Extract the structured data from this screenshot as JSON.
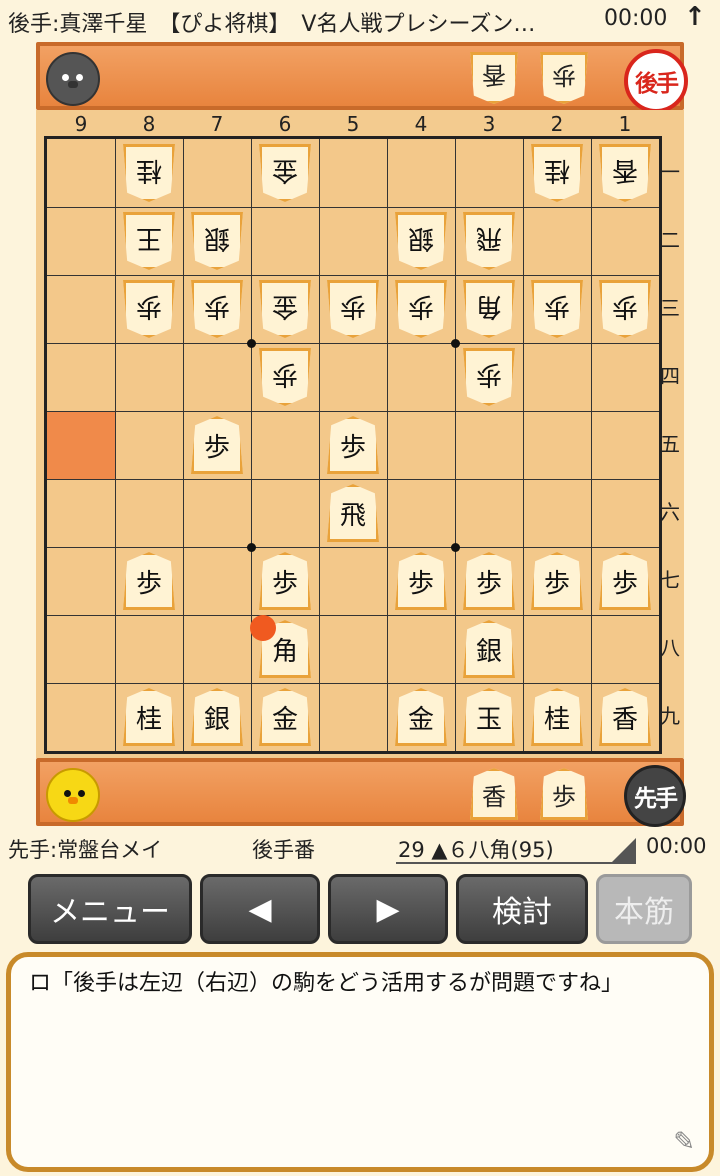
{
  "header": {
    "title": "後手:真澤千星　【ぴよ将棋】　V名人戦プレシーズン…",
    "clock": "00:00",
    "arrow_icon": "up-arrow-icon"
  },
  "gote": {
    "badge": "後手",
    "hand": [
      "香",
      "歩"
    ]
  },
  "sente": {
    "badge": "先手",
    "hand": [
      "香",
      "歩"
    ]
  },
  "files": [
    "9",
    "8",
    "7",
    "6",
    "5",
    "4",
    "3",
    "2",
    "1"
  ],
  "ranks": [
    "一",
    "二",
    "三",
    "四",
    "五",
    "六",
    "七",
    "八",
    "九"
  ],
  "board": [
    {
      "file": 8,
      "rank": 1,
      "piece": "桂",
      "owner": "gote"
    },
    {
      "file": 6,
      "rank": 1,
      "piece": "金",
      "owner": "gote"
    },
    {
      "file": 2,
      "rank": 1,
      "piece": "桂",
      "owner": "gote"
    },
    {
      "file": 1,
      "rank": 1,
      "piece": "香",
      "owner": "gote"
    },
    {
      "file": 8,
      "rank": 2,
      "piece": "王",
      "owner": "gote"
    },
    {
      "file": 7,
      "rank": 2,
      "piece": "銀",
      "owner": "gote"
    },
    {
      "file": 4,
      "rank": 2,
      "piece": "銀",
      "owner": "gote"
    },
    {
      "file": 3,
      "rank": 2,
      "piece": "飛",
      "owner": "gote"
    },
    {
      "file": 8,
      "rank": 3,
      "piece": "歩",
      "owner": "gote"
    },
    {
      "file": 7,
      "rank": 3,
      "piece": "歩",
      "owner": "gote"
    },
    {
      "file": 6,
      "rank": 3,
      "piece": "金",
      "owner": "gote"
    },
    {
      "file": 5,
      "rank": 3,
      "piece": "歩",
      "owner": "gote"
    },
    {
      "file": 4,
      "rank": 3,
      "piece": "歩",
      "owner": "gote"
    },
    {
      "file": 3,
      "rank": 3,
      "piece": "角",
      "owner": "gote"
    },
    {
      "file": 2,
      "rank": 3,
      "piece": "歩",
      "owner": "gote"
    },
    {
      "file": 1,
      "rank": 3,
      "piece": "歩",
      "owner": "gote"
    },
    {
      "file": 6,
      "rank": 4,
      "piece": "歩",
      "owner": "gote"
    },
    {
      "file": 3,
      "rank": 4,
      "piece": "歩",
      "owner": "gote"
    },
    {
      "file": 7,
      "rank": 5,
      "piece": "歩",
      "owner": "sente"
    },
    {
      "file": 5,
      "rank": 5,
      "piece": "歩",
      "owner": "sente"
    },
    {
      "file": 5,
      "rank": 6,
      "piece": "飛",
      "owner": "sente"
    },
    {
      "file": 8,
      "rank": 7,
      "piece": "歩",
      "owner": "sente"
    },
    {
      "file": 6,
      "rank": 7,
      "piece": "歩",
      "owner": "sente"
    },
    {
      "file": 4,
      "rank": 7,
      "piece": "歩",
      "owner": "sente"
    },
    {
      "file": 3,
      "rank": 7,
      "piece": "歩",
      "owner": "sente"
    },
    {
      "file": 2,
      "rank": 7,
      "piece": "歩",
      "owner": "sente"
    },
    {
      "file": 1,
      "rank": 7,
      "piece": "歩",
      "owner": "sente"
    },
    {
      "file": 6,
      "rank": 8,
      "piece": "角",
      "owner": "sente"
    },
    {
      "file": 3,
      "rank": 8,
      "piece": "銀",
      "owner": "sente"
    },
    {
      "file": 8,
      "rank": 9,
      "piece": "桂",
      "owner": "sente"
    },
    {
      "file": 7,
      "rank": 9,
      "piece": "銀",
      "owner": "sente"
    },
    {
      "file": 6,
      "rank": 9,
      "piece": "金",
      "owner": "sente"
    },
    {
      "file": 4,
      "rank": 9,
      "piece": "金",
      "owner": "sente"
    },
    {
      "file": 3,
      "rank": 9,
      "piece": "玉",
      "owner": "sente"
    },
    {
      "file": 2,
      "rank": 9,
      "piece": "桂",
      "owner": "sente"
    },
    {
      "file": 1,
      "rank": 9,
      "piece": "香",
      "owner": "sente"
    }
  ],
  "highlight_square": {
    "file": 9,
    "rank": 5
  },
  "last_move_marker": {
    "file": 6,
    "rank": 8
  },
  "info": {
    "sente_name": "先手:常盤台メイ",
    "turn": "後手番",
    "move": "29 ▲６八角(95)",
    "clock": "00:00"
  },
  "buttons": {
    "menu": "メニュー",
    "prev": "◀",
    "next": "▶",
    "analyze": "検討",
    "mainline": "本筋"
  },
  "comment": {
    "text": "ロ「後手は左辺（右辺）の駒をどう活用するが問題ですね」",
    "pencil_icon": "pencil-icon"
  },
  "colors": {
    "hand_bg": "#e8843e",
    "board_bg": "#f3c88a",
    "highlight": "#f08a4a",
    "last_move": "#f05a20",
    "gote_badge": "#d9261c",
    "comment_border": "#c88a2a"
  }
}
